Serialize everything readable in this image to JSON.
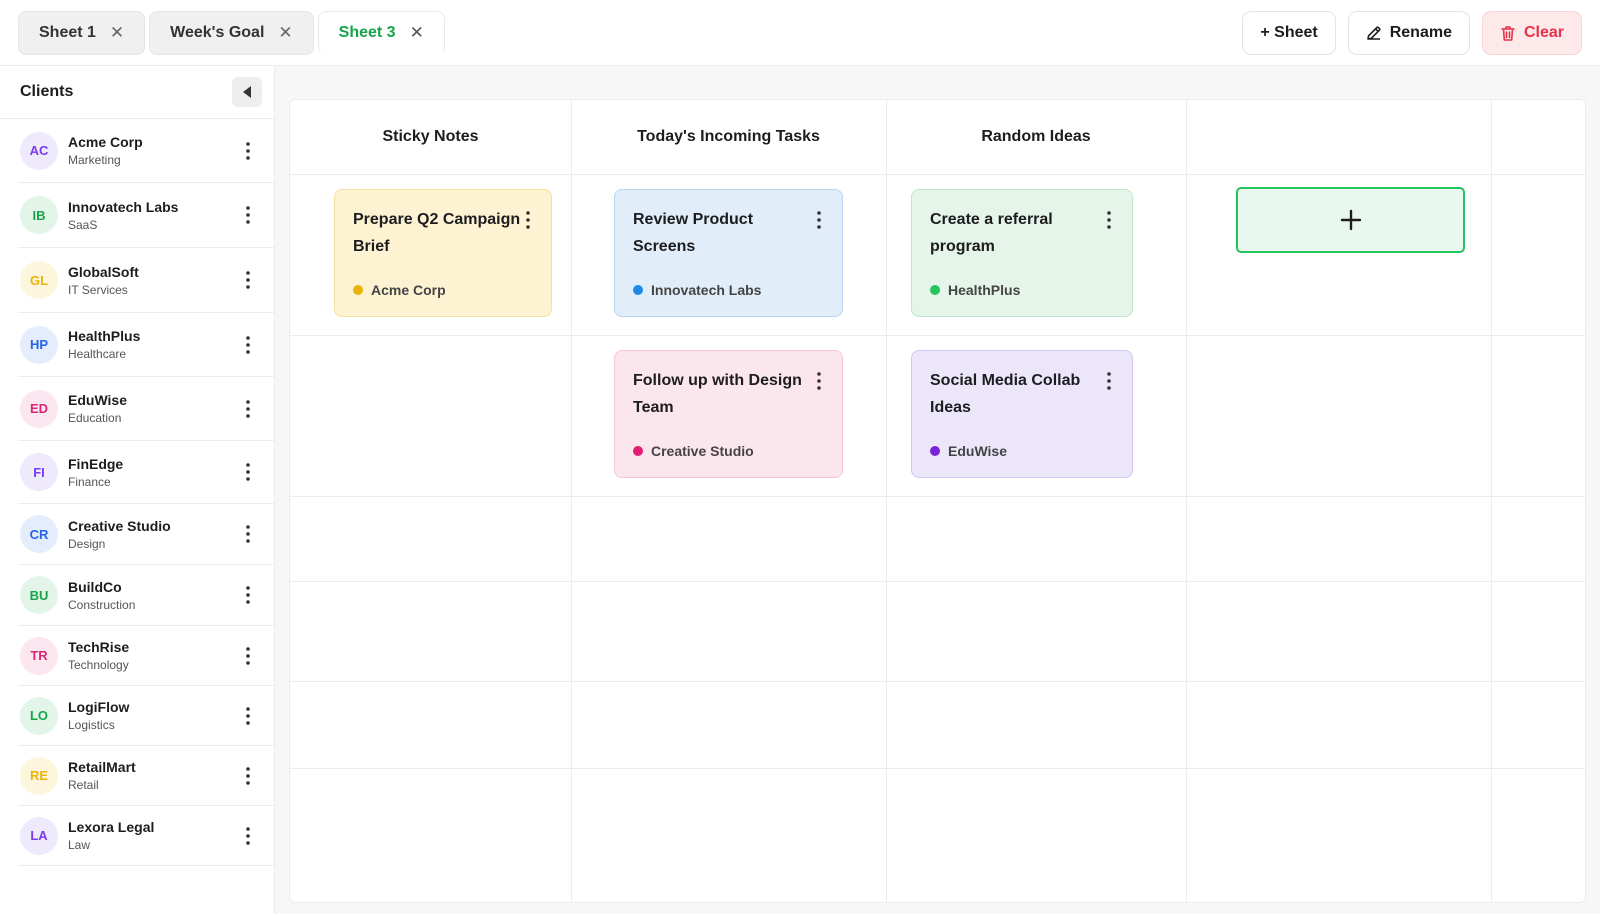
{
  "tabs": [
    {
      "label": "Sheet 1"
    },
    {
      "label": "Week's Goal"
    },
    {
      "label": "Sheet 3",
      "active": true
    }
  ],
  "actions": {
    "add_sheet": "+ Sheet",
    "rename": "Rename",
    "clear": "Clear"
  },
  "sidebar": {
    "title": "Clients",
    "clients": [
      {
        "initials": "AC",
        "name": "Acme Corp",
        "category": "Marketing",
        "color": "#7c3aed",
        "bg": "#efe9fc"
      },
      {
        "initials": "IB",
        "name": "Innovatech Labs",
        "category": "SaaS",
        "color": "#16a34a",
        "bg": "#e3f5e8"
      },
      {
        "initials": "GL",
        "name": "GlobalSoft",
        "category": "IT Services",
        "color": "#eab308",
        "bg": "#fdf5dc"
      },
      {
        "initials": "HP",
        "name": "HealthPlus",
        "category": "Healthcare",
        "color": "#2563eb",
        "bg": "#e4edfc"
      },
      {
        "initials": "ED",
        "name": "EduWise",
        "category": "Education",
        "color": "#db2777",
        "bg": "#fce7f1"
      },
      {
        "initials": "FI",
        "name": "FinEdge",
        "category": "Finance",
        "color": "#7c3aed",
        "bg": "#efe9fc"
      },
      {
        "initials": "CR",
        "name": "Creative Studio",
        "category": "Design",
        "color": "#2563eb",
        "bg": "#e4edfc"
      },
      {
        "initials": "BU",
        "name": "BuildCo",
        "category": "Construction",
        "color": "#16a34a",
        "bg": "#e3f5e8"
      },
      {
        "initials": "TR",
        "name": "TechRise",
        "category": "Technology",
        "color": "#db2777",
        "bg": "#fce7f1"
      },
      {
        "initials": "LO",
        "name": "LogiFlow",
        "category": "Logistics",
        "color": "#16a34a",
        "bg": "#e3f5e8"
      },
      {
        "initials": "RE",
        "name": "RetailMart",
        "category": "Retail",
        "color": "#eab308",
        "bg": "#fdf5dc"
      },
      {
        "initials": "LA",
        "name": "Lexora Legal",
        "category": "Law",
        "color": "#7c3aed",
        "bg": "#efe9fc"
      }
    ]
  },
  "board": {
    "columns": [
      "Sticky Notes",
      "Today's Incoming Tasks",
      "Random Ideas",
      ""
    ],
    "cards": [
      {
        "title": "Prepare Q2 Campaign Brief",
        "client": "Acme Corp",
        "bg": "#fdf3d2",
        "border": "#f6e0a0",
        "dot": "#eab308"
      },
      {
        "title": "Review Product Screens",
        "client": "Innovatech Labs",
        "bg": "#e2edfa",
        "border": "#bcd4f2",
        "dot": "#1d8ae6"
      },
      {
        "title": "Create a referral program",
        "client": "HealthPlus",
        "bg": "#e5f5ea",
        "border": "#bfe5cc",
        "dot": "#22c55e"
      },
      {
        "title": "Follow up with Design Team",
        "client": "Creative Studio",
        "bg": "#fce6ee",
        "border": "#f7c6d6",
        "dot": "#e11d74"
      },
      {
        "title": "Social Media Collab Ideas",
        "client": "EduWise",
        "bg": "#ece6fa",
        "border": "#d2c6f2",
        "dot": "#7c22d9"
      }
    ],
    "add_card_label": "+"
  }
}
